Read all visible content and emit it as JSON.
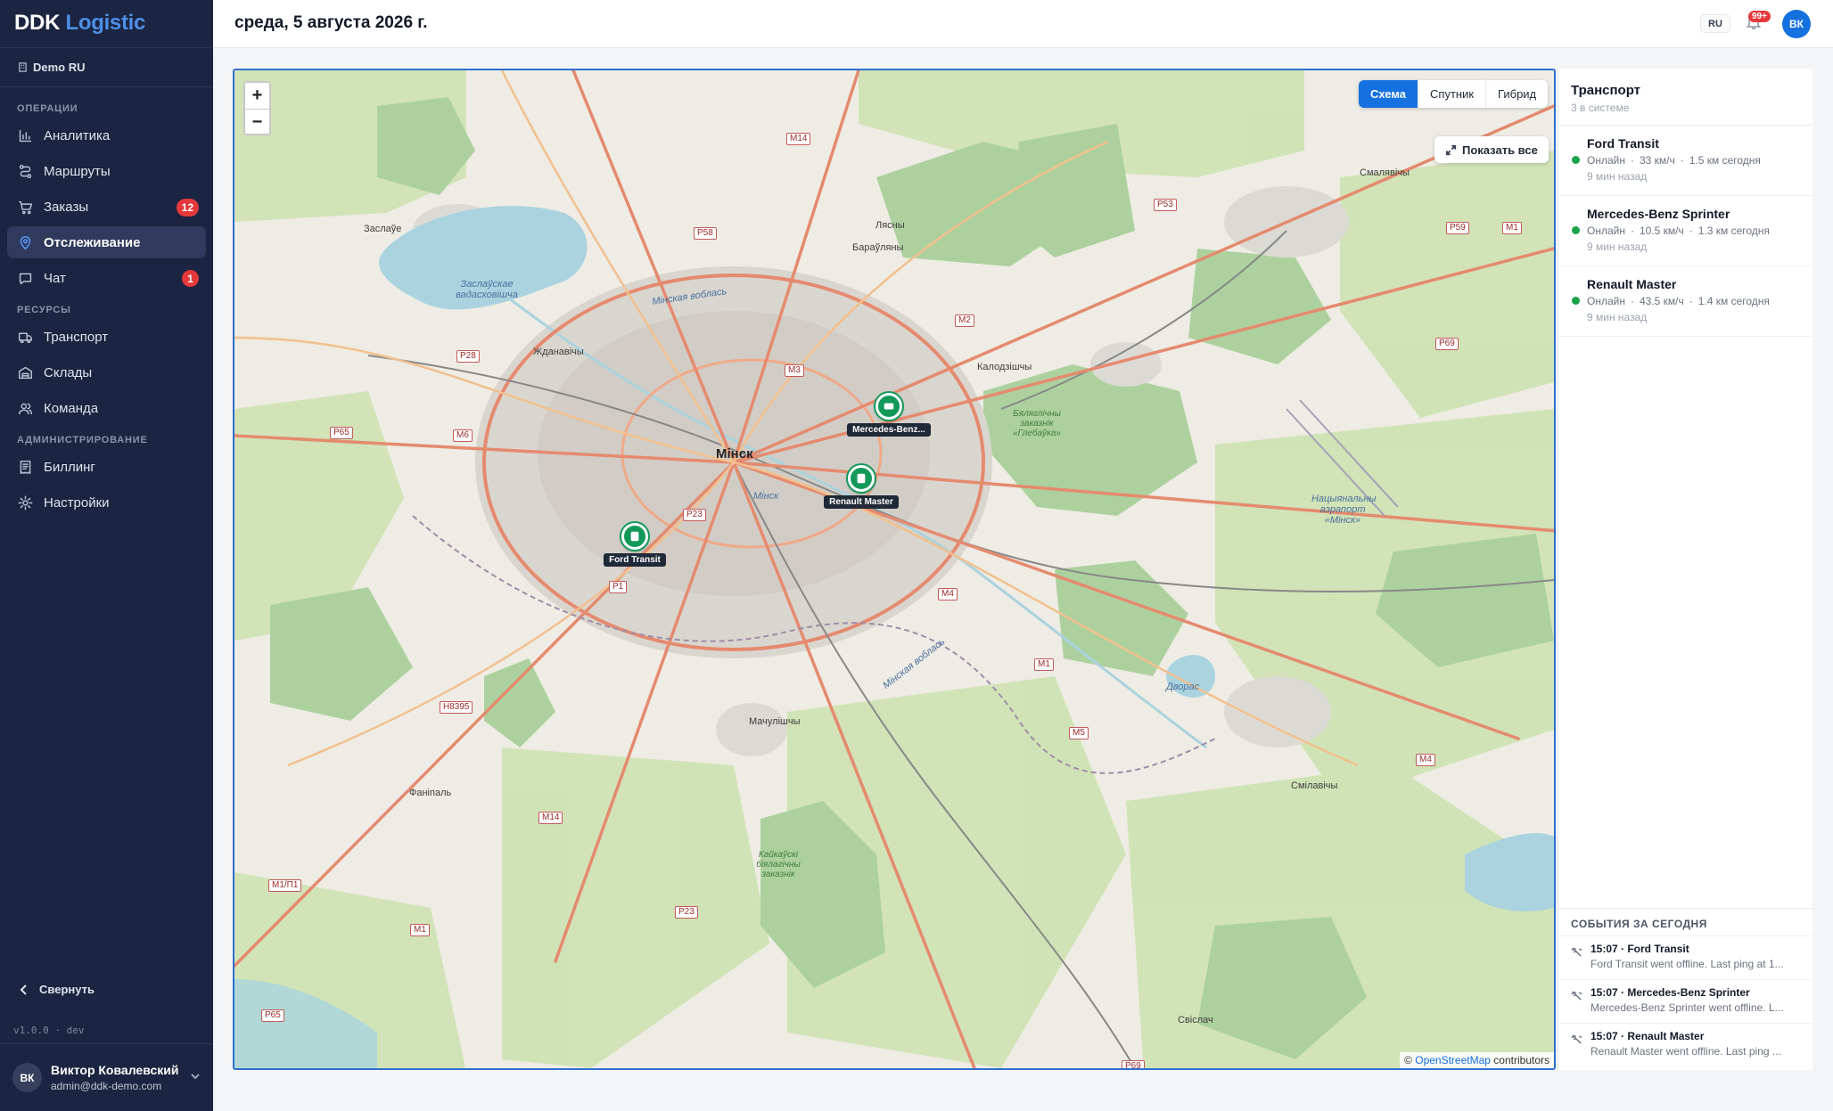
{
  "app": {
    "logo_main": "DDK",
    "logo_accent": "Logistic"
  },
  "sidebar": {
    "workspace": "Demo RU",
    "sections": {
      "operations": "ОПЕРАЦИИ",
      "resources": "РЕСУРСЫ",
      "admin": "АДМИНИСТРИРОВАНИЕ"
    },
    "items": [
      {
        "label": "Аналитика",
        "icon": "bar-chart-icon"
      },
      {
        "label": "Маршруты",
        "icon": "route-icon"
      },
      {
        "label": "Заказы",
        "icon": "cart-icon",
        "badge": "12"
      },
      {
        "label": "Отслеживание",
        "icon": "map-pin-icon",
        "active": true
      },
      {
        "label": "Чат",
        "icon": "chat-icon",
        "badge": "1"
      },
      {
        "label": "Транспорт",
        "icon": "truck-icon"
      },
      {
        "label": "Склады",
        "icon": "warehouse-icon"
      },
      {
        "label": "Команда",
        "icon": "users-icon"
      },
      {
        "label": "Биллинг",
        "icon": "receipt-icon"
      },
      {
        "label": "Настройки",
        "icon": "gear-icon"
      }
    ],
    "collapse_label": "Свернуть",
    "version": "v1.0.0 · dev",
    "user": {
      "initials": "ВК",
      "name": "Виктор Ковалевский",
      "email": "admin@ddk-demo.com"
    }
  },
  "header": {
    "date": "среда, 5 августа 2026 г.",
    "lang": "RU",
    "notifications_badge": "99+",
    "avatar_initials": "ВК"
  },
  "map": {
    "zoom_in": "+",
    "zoom_out": "−",
    "types": [
      "Схема",
      "Спутник",
      "Гибрид"
    ],
    "active_type": "Схема",
    "show_all": "Показать все",
    "attribution_prefix": "©",
    "attribution_link": "OpenStreetMap",
    "attribution_suffix": "contributors",
    "labels": {
      "minsk": "Мінск",
      "minsk_river": "Мінск",
      "zaslaue": "Заслаўе",
      "lyasny": "Лясны",
      "baraulyany": "Бараўляны",
      "smalyavichy": "Смалявічы",
      "zhdanovichy": "Жданавічы",
      "kalodzishchy": "Калодзішчы",
      "machulishchy": "Мачулішчы",
      "fanipal": "Фаніпаль",
      "smilavichy": "Смілавічы",
      "svislach": "Свіслач",
      "reservoir": "Заслаўскае вадасховішча",
      "ring_road_north": "Мінская воблась",
      "ring_road_south": "Мінская воблась",
      "reserve_glebauka": "Бяляглічны заказнік «Глебаўка»",
      "reserve_south": "Кайкаўскі біялагічны заказнік",
      "airport": "Нацыянальны аэрапорт «Мінск»",
      "dvorishche": "Дворас"
    },
    "roads": [
      "M14",
      "P58",
      "P53",
      "P59",
      "M1",
      "M2",
      "P28",
      "M3",
      "P69",
      "P65",
      "M6",
      "P23",
      "P1",
      "M4",
      "M1",
      "H8395",
      "M5",
      "M4",
      "M14",
      "M1/П1",
      "P23",
      "M1",
      "P65",
      "P69"
    ],
    "markers": [
      {
        "label": "Ford Transit"
      },
      {
        "label": "Mercedes-Benz..."
      },
      {
        "label": "Renault Master"
      }
    ]
  },
  "panel": {
    "title": "Транспорт",
    "subtitle": "3 в системе",
    "vehicles": [
      {
        "name": "Ford Transit",
        "status": "Онлайн",
        "speed": "33 км/ч",
        "distance": "1.5 км сегодня",
        "ago": "9 мин назад"
      },
      {
        "name": "Mercedes-Benz Sprinter",
        "status": "Онлайн",
        "speed": "10.5 км/ч",
        "distance": "1.3 км сегодня",
        "ago": "9 мин назад"
      },
      {
        "name": "Renault Master",
        "status": "Онлайн",
        "speed": "43.5 км/ч",
        "distance": "1.4 км сегодня",
        "ago": "9 мин назад"
      }
    ],
    "events_title": "СОБЫТИЯ ЗА СЕГОДНЯ",
    "events": [
      {
        "title": "15:07 · Ford Transit",
        "text": "Ford Transit went offline. Last ping at 1..."
      },
      {
        "title": "15:07 · Mercedes-Benz Sprinter",
        "text": "Mercedes-Benz Sprinter went offline. L..."
      },
      {
        "title": "15:07 · Renault Master",
        "text": "Renault Master went offline. Last ping ..."
      }
    ],
    "status_color": "#1aa34a",
    "accent_color": "#1570e0"
  }
}
